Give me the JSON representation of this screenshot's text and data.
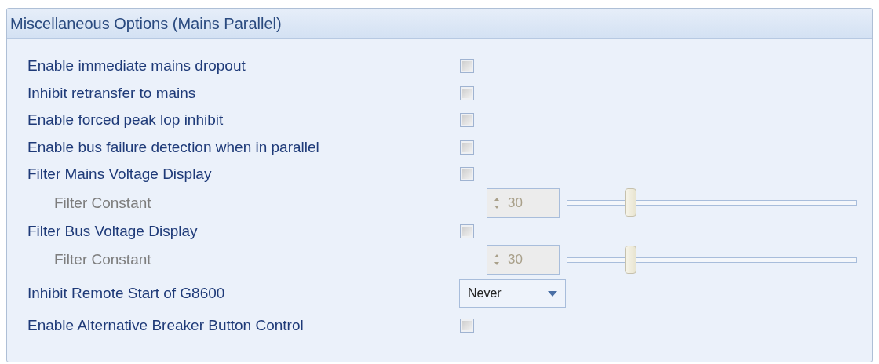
{
  "panel": {
    "title": "Miscellaneous Options (Mains Parallel)"
  },
  "options": [
    {
      "kind": "checkbox",
      "label": "Enable immediate mains dropout",
      "checked": false
    },
    {
      "kind": "checkbox",
      "label": "Inhibit retransfer to mains",
      "checked": false
    },
    {
      "kind": "checkbox",
      "label": "Enable forced peak lop inhibit",
      "checked": false
    },
    {
      "kind": "checkbox",
      "label": "Enable bus failure detection when in parallel",
      "checked": false
    },
    {
      "kind": "checkbox",
      "label": "Filter Mains Voltage Display",
      "checked": false
    },
    {
      "kind": "slider",
      "label": "Filter Constant",
      "value": "30",
      "level": 0.22,
      "disabled": true
    },
    {
      "kind": "checkbox",
      "label": "Filter Bus Voltage Display",
      "checked": false
    },
    {
      "kind": "slider",
      "label": "Filter Constant",
      "value": "30",
      "level": 0.22,
      "disabled": true
    },
    {
      "kind": "dropdown",
      "label": "Inhibit Remote Start of G8600",
      "value": "Never"
    },
    {
      "kind": "checkbox",
      "label": "Enable Alternative Breaker Button Control",
      "checked": false
    }
  ]
}
